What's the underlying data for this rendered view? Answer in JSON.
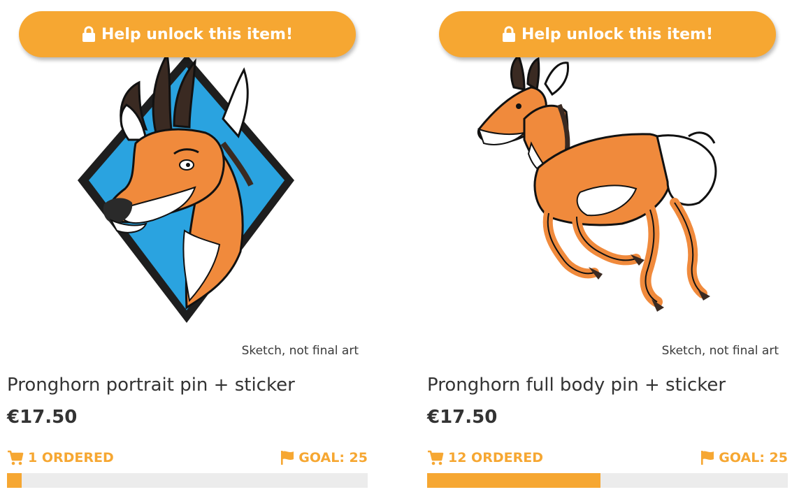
{
  "colors": {
    "accent": "#f6a732",
    "track": "#ececec",
    "text": "#333333"
  },
  "products": [
    {
      "unlock_label": "Help unlock this item!",
      "unlock_icon": "lock-icon",
      "art_note": "Sketch, not final art",
      "title": "Pronghorn portrait pin + sticker",
      "price": "€17.50",
      "ordered_label": "1 ORDERED",
      "goal_label": "GOAL: 25",
      "ordered_count": 1,
      "goal_count": 25,
      "progress_fraction": 0.04
    },
    {
      "unlock_label": "Help unlock this item!",
      "unlock_icon": "lock-icon",
      "art_note": "Sketch, not final art",
      "title": "Pronghorn full body pin + sticker",
      "price": "€17.50",
      "ordered_label": "12 ORDERED",
      "goal_label": "GOAL: 25",
      "ordered_count": 12,
      "goal_count": 25,
      "progress_fraction": 0.48
    }
  ]
}
